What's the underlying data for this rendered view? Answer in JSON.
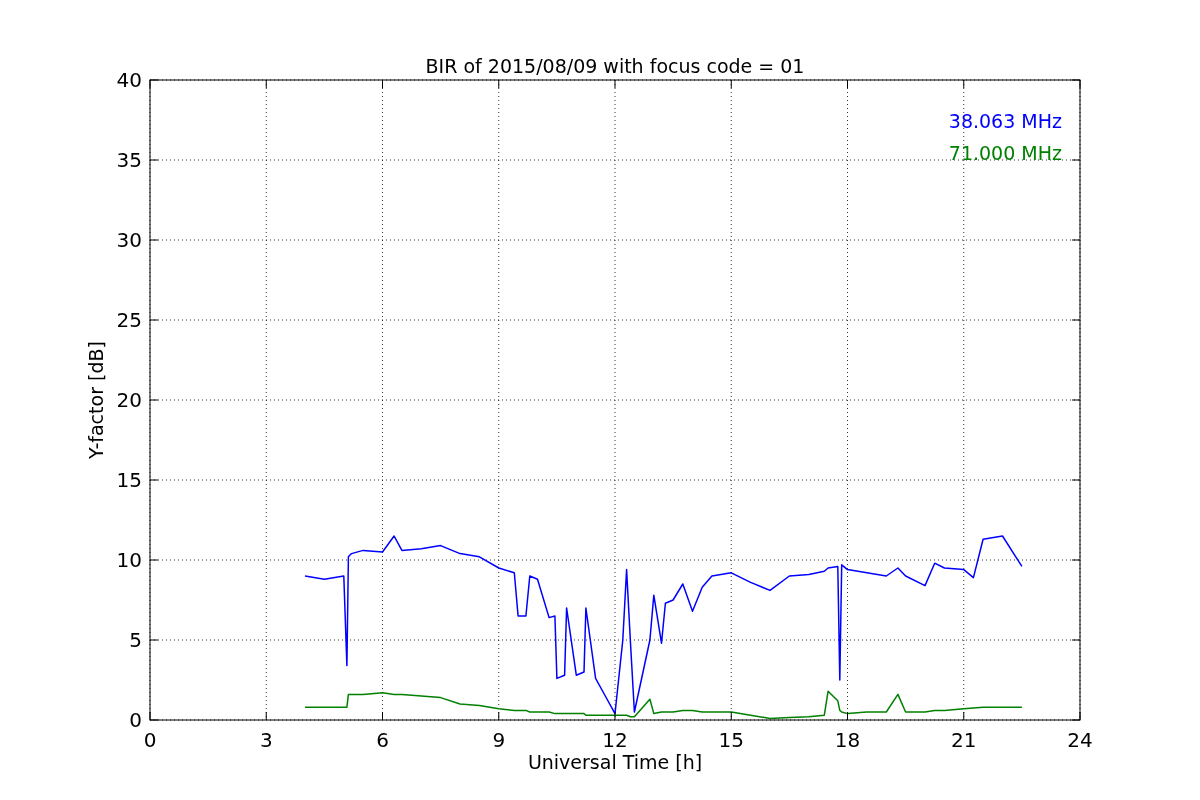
{
  "chart_data": {
    "type": "line",
    "title": "BIR of 2015/08/09 with focus code = 01",
    "xlabel": "Universal Time [h]",
    "ylabel": "Y-factor [dB]",
    "x": [
      4,
      4.5,
      5,
      5.08,
      5.12,
      5.2,
      5.5,
      6,
      6.3,
      6.5,
      7,
      7.5,
      8,
      8.5,
      9,
      9.4,
      9.5,
      9.7,
      9.8,
      10,
      10.3,
      10.45,
      10.5,
      10.7,
      10.75,
      11,
      11.2,
      11.25,
      11.5,
      11.75,
      12,
      12.2,
      12.3,
      12.4,
      12.5,
      12.9,
      13,
      13.2,
      13.3,
      13.5,
      13.75,
      14,
      14.25,
      14.5,
      15,
      15.5,
      16,
      16.5,
      17,
      17.4,
      17.5,
      17.75,
      17.8,
      17.85,
      18,
      18.5,
      19,
      19.3,
      19.5,
      20,
      20.25,
      20.5,
      21,
      21.25,
      21.5,
      22,
      22.5
    ],
    "series": [
      {
        "name": "38.063 MHz",
        "color": "#0000ff",
        "values": [
          9,
          8.8,
          9,
          3.4,
          10.2,
          10.4,
          10.6,
          10.5,
          11.5,
          10.6,
          10.7,
          10.9,
          10.4,
          10.2,
          9.5,
          9.2,
          6.5,
          6.5,
          9,
          8.8,
          6.4,
          6.5,
          2.6,
          2.8,
          7,
          2.8,
          3,
          7,
          2.6,
          1.5,
          0.4,
          5,
          9.4,
          4.8,
          0.5,
          5,
          7.8,
          4.8,
          7.3,
          7.5,
          8.5,
          6.8,
          8.3,
          9,
          9.2,
          8.6,
          8.1,
          9,
          9.1,
          9.3,
          9.5,
          9.6,
          2.5,
          9.7,
          9.4,
          9.2,
          9,
          9.5,
          9,
          8.4,
          9.8,
          9.5,
          9.4,
          8.9,
          11.3,
          11.5,
          9.6
        ]
      },
      {
        "name": "71.000 MHz",
        "color": "#008000",
        "values": [
          0.8,
          0.8,
          0.8,
          0.8,
          1.6,
          1.6,
          1.6,
          1.7,
          1.6,
          1.6,
          1.5,
          1.4,
          1.0,
          0.9,
          0.7,
          0.6,
          0.6,
          0.6,
          0.5,
          0.5,
          0.5,
          0.4,
          0.4,
          0.4,
          0.4,
          0.4,
          0.4,
          0.3,
          0.3,
          0.3,
          0.3,
          0.3,
          0.3,
          0.2,
          0.2,
          1.3,
          0.4,
          0.5,
          0.5,
          0.5,
          0.6,
          0.6,
          0.5,
          0.5,
          0.5,
          0.3,
          0.1,
          0.15,
          0.2,
          0.3,
          1.8,
          1.2,
          0.6,
          0.5,
          0.4,
          0.5,
          0.5,
          1.6,
          0.5,
          0.5,
          0.6,
          0.6,
          0.7,
          0.75,
          0.8,
          0.8,
          0.8
        ]
      }
    ],
    "grid": true,
    "xlim": [
      0,
      24
    ],
    "ylim": [
      0,
      40
    ],
    "xticks": [
      0,
      3,
      6,
      9,
      12,
      15,
      18,
      21,
      24
    ],
    "yticks": [
      0,
      5,
      10,
      15,
      20,
      25,
      30,
      35,
      40
    ]
  }
}
